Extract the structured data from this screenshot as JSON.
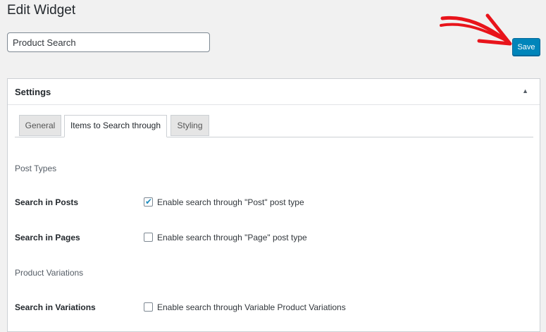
{
  "header": {
    "title": "Edit Widget",
    "widget_name_value": "Product Search",
    "save_label": "Save"
  },
  "panel": {
    "title": "Settings",
    "toggle_glyph": "▲",
    "tabs": [
      {
        "label": "General",
        "active": false
      },
      {
        "label": "Items to Search through",
        "active": true
      },
      {
        "label": "Styling",
        "active": false
      }
    ]
  },
  "sections": {
    "post_types": "Post Types",
    "product_variations": "Product Variations"
  },
  "rows": [
    {
      "label": "Search in Posts",
      "checkbox_label": "Enable search through \"Post\" post type",
      "checked": true
    },
    {
      "label": "Search in Pages",
      "checkbox_label": "Enable search through \"Page\" post type",
      "checked": false
    },
    {
      "label": "Search in Variations",
      "checkbox_label": "Enable search through Variable Product Variations",
      "checked": false
    }
  ],
  "colors": {
    "primary_button": "#0085ba",
    "annotation_arrow": "#e8141b",
    "checkbox_check": "#1e8cbe"
  },
  "icons": {
    "collapse": "caret-up-icon",
    "check": "checkmark-icon",
    "annotation": "red-arrow-icon"
  }
}
